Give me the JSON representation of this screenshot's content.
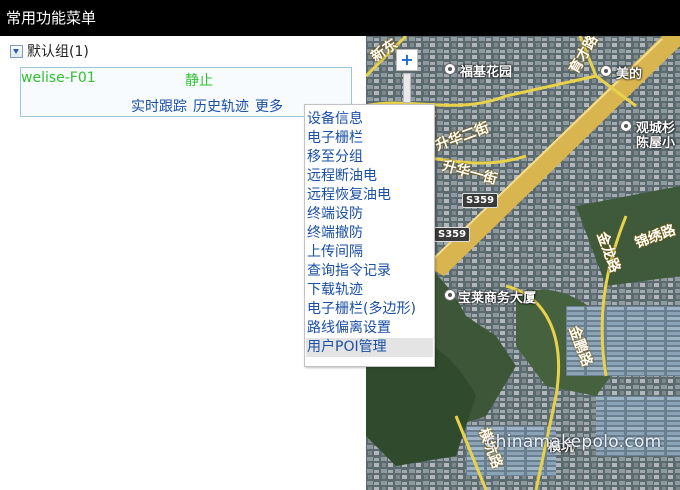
{
  "header": {
    "title": "常用功能菜单"
  },
  "group": {
    "label": "默认组(1)"
  },
  "device": {
    "name": "welise-F01",
    "status": "静止",
    "actions": [
      "实时跟踪",
      "历史轨迹",
      "更多"
    ]
  },
  "context_menu": {
    "items": [
      "设备信息",
      "电子栅栏",
      "移至分组",
      "远程断油电",
      "远程恢复油电",
      "终端设防",
      "终端撤防",
      "上传间隔",
      "查询指令记录",
      "下载轨迹",
      "电子栅栏(多边形)",
      "路线偏离设置",
      "用户POI管理"
    ],
    "highlighted_index": 12
  },
  "map": {
    "zoom_in_label": "+",
    "labels": [
      "福基花园",
      "美的",
      "观城杉",
      "陈屋小",
      "宝莱商务大厦",
      "横坑"
    ],
    "road_names": [
      "新东",
      "一街",
      "升华二街",
      "升华一街",
      "金鹏路",
      "锦绣路",
      "金龙路",
      "育才路",
      "横坑路"
    ],
    "highway_shields": [
      "S359",
      "S359"
    ],
    "colors": {
      "highway": "#d9b550",
      "road": "#e8d24a"
    }
  },
  "watermark": "chinamakepolo.com"
}
